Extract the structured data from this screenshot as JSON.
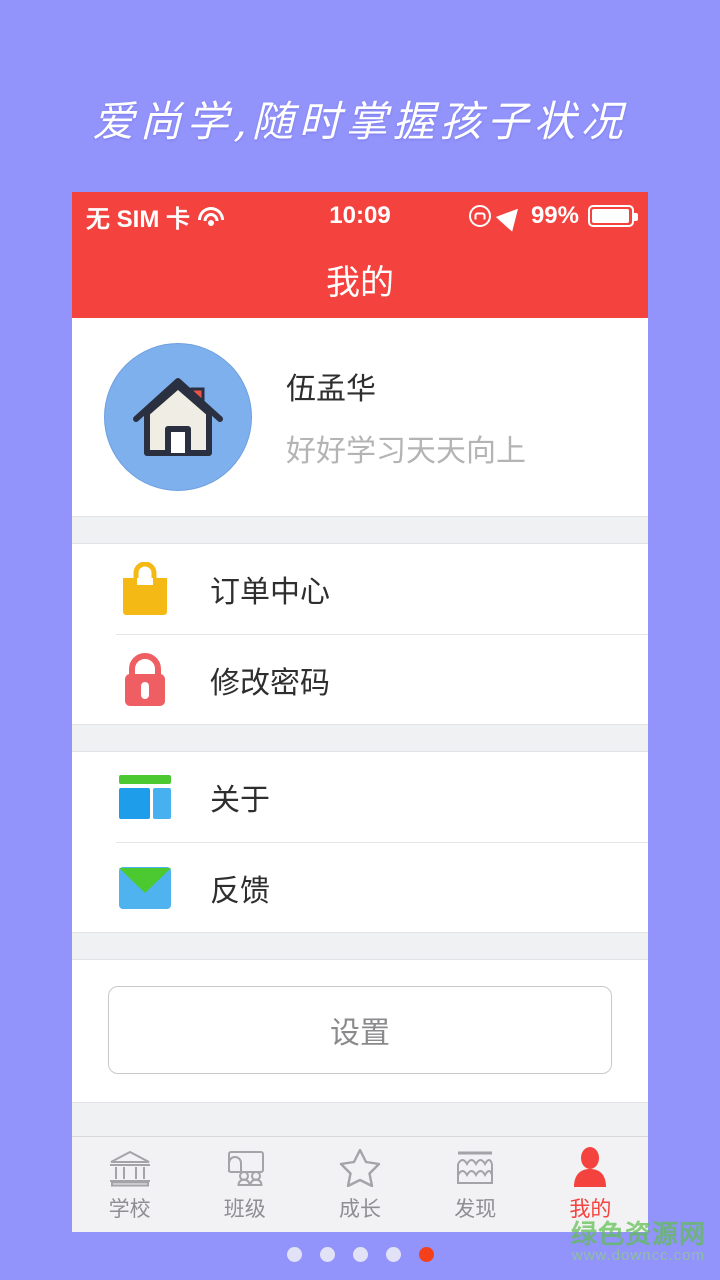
{
  "theme": {
    "page_background": "#9293fb",
    "accent_red": "#f4433f",
    "tabbar_background": "#f2f2f4",
    "gap_band": "#f0f1f3",
    "avatar_blue": "#7fb0ee",
    "order_icon": "#f5b916",
    "lock_icon": "#ef5e63",
    "about_green": "#4cc830",
    "about_blue": "#1e9eea",
    "mail_blue": "#4eb3ee",
    "dot_active": "#f4411c"
  },
  "banner": {
    "headline": "爱尚学,随时掌握孩子状况"
  },
  "statusbar": {
    "carrier": "无 SIM 卡",
    "wifi_icon": "wifi-icon",
    "time": "10:09",
    "rotation_lock_icon": "rotation-lock-icon",
    "location_icon": "location-arrow-icon",
    "battery_percent": "99%",
    "battery_icon": "battery-icon"
  },
  "navbar": {
    "title": "我的"
  },
  "profile": {
    "avatar_icon": "house-avatar-icon",
    "name": "伍孟华",
    "motto": "好好学习天天向上"
  },
  "menu_groups": [
    {
      "items": [
        {
          "icon": "shopping-bag-icon",
          "label": "订单中心"
        },
        {
          "icon": "lock-icon",
          "label": "修改密码"
        }
      ]
    },
    {
      "items": [
        {
          "icon": "layout-panels-icon",
          "label": "关于"
        },
        {
          "icon": "envelope-icon",
          "label": "反馈"
        }
      ]
    }
  ],
  "settings": {
    "label": "设置"
  },
  "tabbar": {
    "items": [
      {
        "icon": "school-building-icon",
        "label": "学校",
        "active": false
      },
      {
        "icon": "classroom-icon",
        "label": "班级",
        "active": false
      },
      {
        "icon": "star-icon",
        "label": "成长",
        "active": false
      },
      {
        "icon": "storefront-icon",
        "label": "发现",
        "active": false
      },
      {
        "icon": "person-icon",
        "label": "我的",
        "active": true
      }
    ]
  },
  "pager": {
    "total": 5,
    "active_index": 4
  },
  "watermark": {
    "site_name": "绿色资源网",
    "url": "www.downcc.com"
  }
}
